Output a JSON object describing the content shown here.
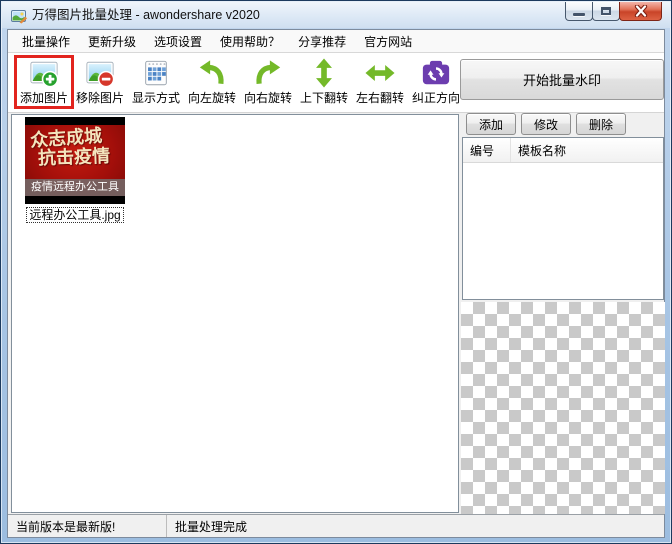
{
  "window": {
    "title": "万得图片批量处理 - awondershare v2020"
  },
  "menu": {
    "items": [
      "批量操作",
      "更新升级",
      "选项设置",
      "使用帮助？",
      "分享推荐",
      "官方网站"
    ]
  },
  "toolbar": {
    "buttons": [
      {
        "label": "添加图片",
        "icon": "add-image-icon",
        "highlighted": true
      },
      {
        "label": "移除图片",
        "icon": "remove-image-icon",
        "highlighted": false
      },
      {
        "label": "显示方式",
        "icon": "display-mode-icon",
        "highlighted": false
      },
      {
        "label": "向左旋转",
        "icon": "rotate-left-icon",
        "highlighted": false
      },
      {
        "label": "向右旋转",
        "icon": "rotate-right-icon",
        "highlighted": false
      },
      {
        "label": "上下翻转",
        "icon": "flip-vertical-icon",
        "highlighted": false
      },
      {
        "label": "左右翻转",
        "icon": "flip-horizontal-icon",
        "highlighted": false
      },
      {
        "label": "纠正方向",
        "icon": "correct-orientation-icon",
        "highlighted": false
      }
    ],
    "start_watermark_label": "开始批量水印"
  },
  "image_list": {
    "items": [
      {
        "filename": "远程办公工具.jpg",
        "thumb_text_line1": "众志成城",
        "thumb_text_line2": "抗击疫情",
        "thumb_caption": "疫情远程办公工具",
        "selected": true
      }
    ]
  },
  "template_panel": {
    "add_label": "添加",
    "modify_label": "修改",
    "delete_label": "删除",
    "table_headers": [
      "编号",
      "模板名称"
    ],
    "rows": []
  },
  "status_bar": {
    "left": "当前版本是最新版!",
    "right": "批量处理完成"
  },
  "colors": {
    "accent_green": "#74B929",
    "accent_purple": "#6C3DAF",
    "highlight_red": "#E2241E",
    "checker_gray": "#C9C9C9",
    "close_button_red": "#C94428"
  }
}
